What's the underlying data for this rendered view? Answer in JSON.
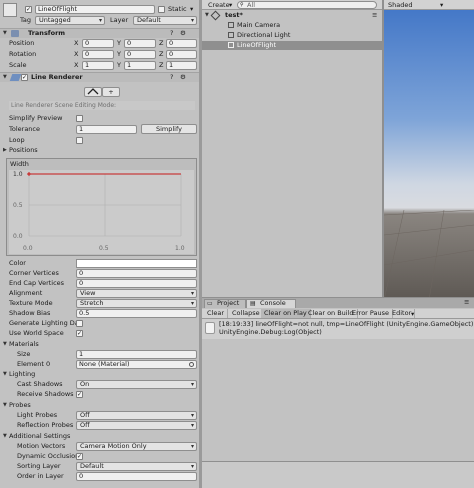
{
  "inspector": {
    "object_name": "LineOfFlight",
    "static_label": "Static",
    "tag_label": "Tag",
    "tag_value": "Untagged",
    "layer_label": "Layer",
    "layer_value": "Default",
    "transform": {
      "title": "Transform",
      "position_label": "Position",
      "rotation_label": "Rotation",
      "scale_label": "Scale",
      "position": {
        "x": "0",
        "y": "0",
        "z": "0"
      },
      "rotation": {
        "x": "0",
        "y": "0",
        "z": "0"
      },
      "scale": {
        "x": "1",
        "y": "1",
        "z": "1"
      }
    },
    "line_renderer": {
      "title": "Line Renderer",
      "edit_mode_label": "Line Renderer Scene Editing Mode:",
      "simplify_preview_label": "Simplify Preview",
      "tolerance_label": "Tolerance",
      "tolerance_value": "1",
      "simplify_button": "Simplify",
      "loop_label": "Loop",
      "positions_label": "Positions",
      "width_label": "Width",
      "graph_y_ticks": [
        "1.0",
        "0.5",
        "0.0"
      ],
      "graph_x_ticks": [
        "0.0",
        "0.5",
        "1.0"
      ],
      "width_curve": [
        {
          "t": 0,
          "w": 1.0
        },
        {
          "t": 1,
          "w": 1.0
        }
      ],
      "color_label": "Color",
      "corner_vertices_label": "Corner Vertices",
      "corner_vertices_value": "0",
      "end_cap_vertices_label": "End Cap Vertices",
      "end_cap_vertices_value": "0",
      "alignment_label": "Alignment",
      "alignment_value": "View",
      "texture_mode_label": "Texture Mode",
      "texture_mode_value": "Stretch",
      "shadow_bias_label": "Shadow Bias",
      "shadow_bias_value": "0.5",
      "generate_lighting_label": "Generate Lighting Da",
      "use_world_space_label": "Use World Space"
    },
    "materials": {
      "title": "Materials",
      "size_label": "Size",
      "size_value": "1",
      "element0_label": "Element 0",
      "element0_value": "None (Material)"
    },
    "lighting": {
      "title": "Lighting",
      "cast_shadows_label": "Cast Shadows",
      "cast_shadows_value": "On",
      "receive_shadows_label": "Receive Shadows"
    },
    "probes": {
      "title": "Probes",
      "light_probes_label": "Light Probes",
      "light_probes_value": "Off",
      "reflection_probes_label": "Reflection Probes",
      "reflection_probes_value": "Off"
    },
    "additional": {
      "title": "Additional Settings",
      "motion_vectors_label": "Motion Vectors",
      "motion_vectors_value": "Camera Motion Only",
      "dynamic_occlusion_label": "Dynamic Occlusion",
      "sorting_layer_label": "Sorting Layer",
      "sorting_layer_value": "Default",
      "order_in_layer_label": "Order in Layer",
      "order_in_layer_value": "0"
    }
  },
  "hierarchy": {
    "create_label": "Create",
    "search_placeholder": "All",
    "scene_name": "test*",
    "items": [
      "Main Camera",
      "Directional Light",
      "LineOfFlight"
    ]
  },
  "scene": {
    "shading_mode": "Shaded"
  },
  "console": {
    "tabs": [
      "Project",
      "Console"
    ],
    "buttons": [
      "Clear",
      "Collapse",
      "Clear on Play",
      "Clear on Build",
      "Error Pause",
      "Editor"
    ],
    "log_line1": "[18:19:33] lineOfFlight=not null, tmp=LineOfFlight (UnityEngine.GameObject)",
    "log_line2": "UnityEngine.Debug:Log(Object)"
  },
  "colors": {
    "panel_bg": "#c2c2c2",
    "selection": "#8f8f8f",
    "curve": "#c83c3c",
    "sky_top": "#3f74c6",
    "sky_bottom": "#d9dbe0",
    "ground": "#5f5a55"
  }
}
